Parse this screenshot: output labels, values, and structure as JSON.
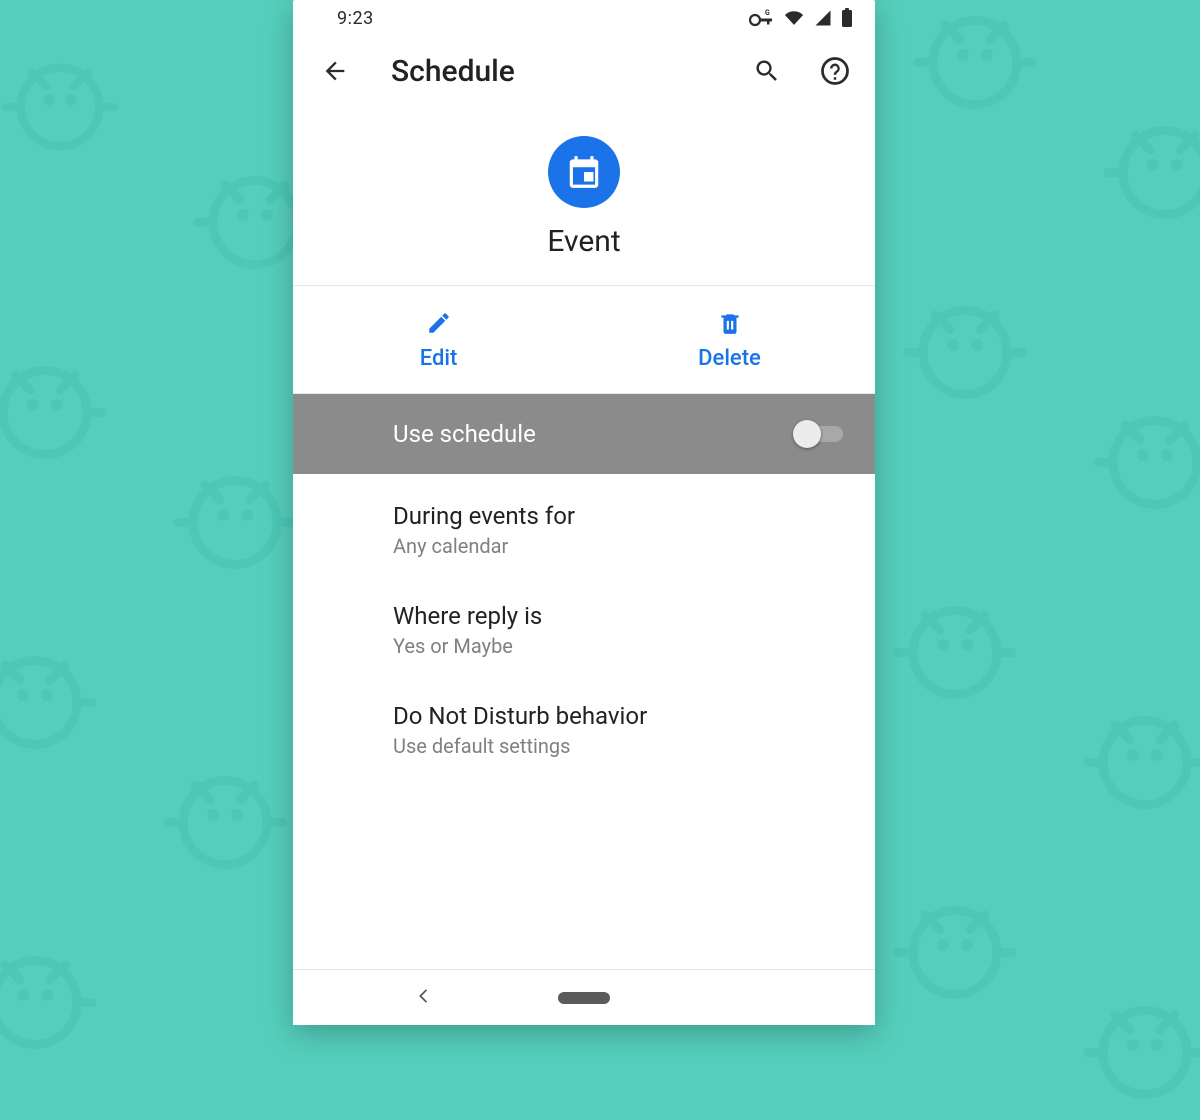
{
  "status": {
    "time": "9:23"
  },
  "appbar": {
    "title": "Schedule"
  },
  "hero": {
    "label": "Event"
  },
  "actions": {
    "edit": "Edit",
    "delete": "Delete"
  },
  "schedule_toggle": {
    "label": "Use schedule",
    "on": false
  },
  "settings": [
    {
      "title": "During events for",
      "sub": "Any calendar"
    },
    {
      "title": "Where reply is",
      "sub": "Yes or Maybe"
    },
    {
      "title": "Do Not Disturb behavior",
      "sub": "Use default settings"
    }
  ]
}
